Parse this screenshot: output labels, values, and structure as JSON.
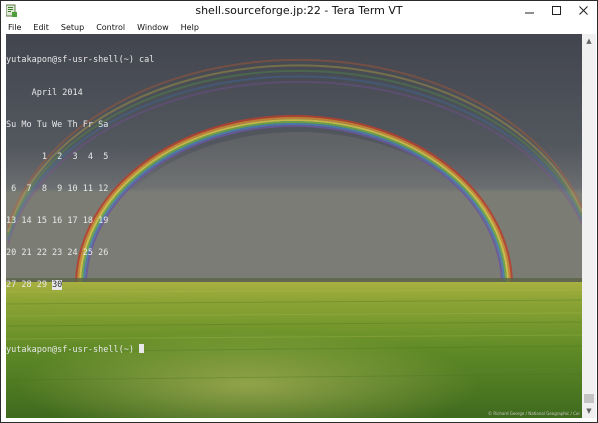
{
  "window": {
    "title": "shell.sourceforge.jp:22 - Tera Term VT",
    "controls": {
      "minimize": "—",
      "maximize": "□",
      "close": "✕"
    }
  },
  "menu": [
    "File",
    "Edit",
    "Setup",
    "Control",
    "Window",
    "Help"
  ],
  "terminal": {
    "prompt_command": "yutakapon@sf-usr-shell(~) cal",
    "calendar_header": "     April 2014",
    "weekday_header": "Su Mo Tu We Th Fr Sa",
    "weeks": [
      "       1  2  3  4  5",
      " 6  7  8  9 10 11 12",
      "13 14 15 16 17 18 19",
      "20 21 22 23 24 25 26"
    ],
    "last_week_prefix": "27 28 29 ",
    "today": "30",
    "blank_line": "",
    "prompt": "yutakapon@sf-usr-shell(~) ",
    "background": {
      "subject": "double-rainbow-over-grassland",
      "sky_color": "#4a4e57",
      "grass_color": "#6b8f28",
      "credit": "© Richard George / National Geographic / Cor"
    }
  },
  "scrollbar": {
    "up_icon": "▲",
    "down_icon": "▼"
  }
}
